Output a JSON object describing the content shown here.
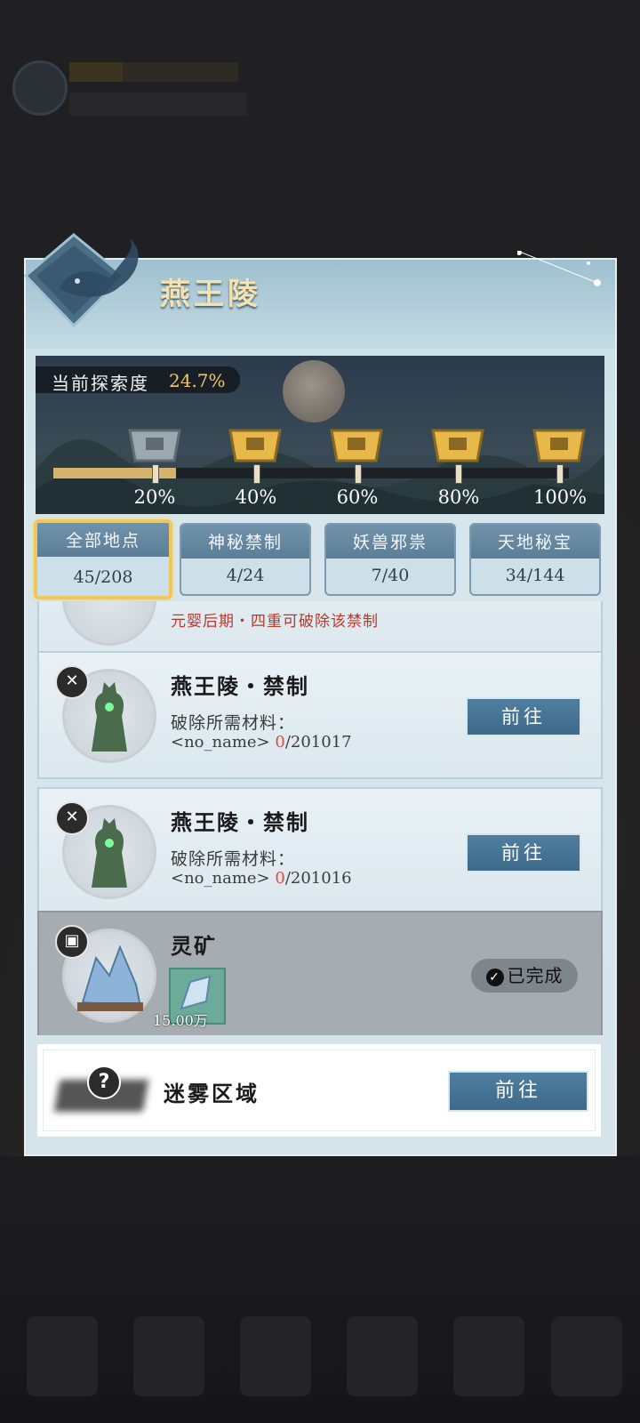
{
  "panel": {
    "title": "燕王陵"
  },
  "exploration": {
    "label": "当前探索度",
    "value": "24.7%",
    "progress_fraction": 0.247,
    "milestones": [
      "20%",
      "40%",
      "60%",
      "80%",
      "100%"
    ]
  },
  "tabs": [
    {
      "label": "全部地点",
      "count": "45/208",
      "active": true
    },
    {
      "label": "神秘禁制",
      "count": "4/24",
      "active": false
    },
    {
      "label": "妖兽邪祟",
      "count": "7/40",
      "active": false
    },
    {
      "label": "天地秘宝",
      "count": "34/144",
      "active": false
    }
  ],
  "list": {
    "partial_warning": "元婴后期・四重可破除该禁制",
    "cards": [
      {
        "title": "燕王陵・禁制",
        "sub": "破除所需材料：",
        "mat_name": "<no_name>",
        "mat_have": "0",
        "mat_need": "/201017",
        "button": "前往"
      },
      {
        "title": "燕王陵・禁制",
        "sub": "破除所需材料：",
        "mat_name": "<no_name>",
        "mat_have": "0",
        "mat_need": "/201016",
        "button": "前往"
      }
    ],
    "done_card": {
      "title": "灵矿",
      "status": "已完成",
      "item_qty": "15.00万"
    }
  },
  "fog": {
    "label": "迷雾区域",
    "button": "前往",
    "icon": "?"
  },
  "colors": {
    "accent_gold": "#f2c75a",
    "button_blue": "#46729a",
    "danger_red": "#e14a3c"
  }
}
